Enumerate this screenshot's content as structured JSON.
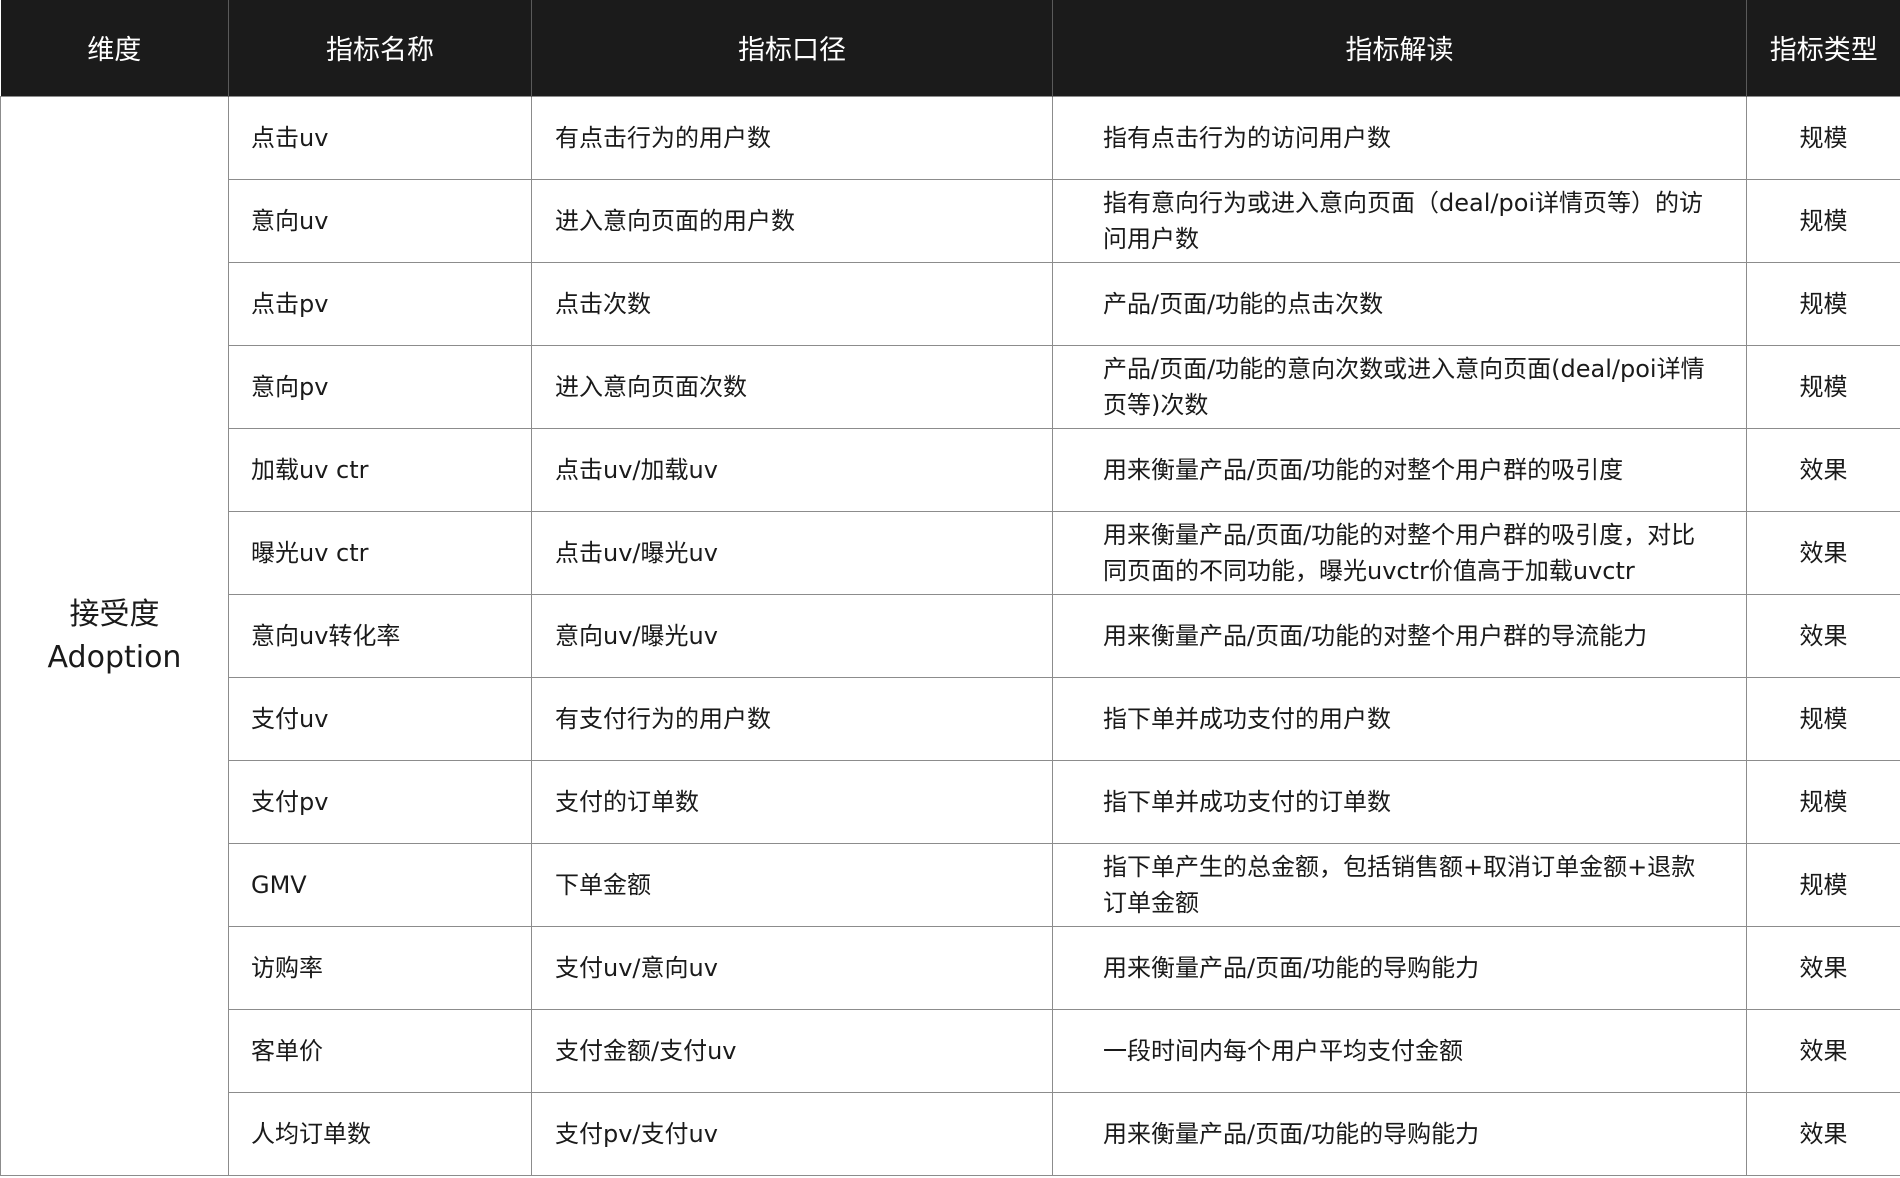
{
  "headers": [
    "维度",
    "指标名称",
    "指标口径",
    "指标解读",
    "指标类型"
  ],
  "dimension": {
    "zh": "接受度",
    "en": "Adoption"
  },
  "rows": [
    {
      "name": "点击uv",
      "definition": "有点击行为的用户数",
      "interpretation": "指有点击行为的访问用户数",
      "type": "规模"
    },
    {
      "name": "意向uv",
      "definition": "进入意向页面的用户数",
      "interpretation": "指有意向行为或进入意向页面（deal/poi详情页等）的访问用户数",
      "type": "规模"
    },
    {
      "name": "点击pv",
      "definition": "点击次数",
      "interpretation": "产品/页面/功能的点击次数",
      "type": "规模"
    },
    {
      "name": "意向pv",
      "definition": "进入意向页面次数",
      "interpretation": "产品/页面/功能的意向次数或进入意向页面(deal/poi详情页等)次数",
      "type": "规模"
    },
    {
      "name": "加载uv ctr",
      "definition": "点击uv/加载uv",
      "interpretation": "用来衡量产品/页面/功能的对整个用户群的吸引度",
      "type": "效果"
    },
    {
      "name": "曝光uv ctr",
      "definition": "点击uv/曝光uv",
      "interpretation": "用来衡量产品/页面/功能的对整个用户群的吸引度，对比同页面的不同功能，曝光uvctr价值高于加载uvctr",
      "type": "效果"
    },
    {
      "name": "意向uv转化率",
      "definition": "意向uv/曝光uv",
      "interpretation": "用来衡量产品/页面/功能的对整个用户群的导流能力",
      "type": "效果"
    },
    {
      "name": "支付uv",
      "definition": "有支付行为的用户数",
      "interpretation": "指下单并成功支付的用户数",
      "type": "规模"
    },
    {
      "name": "支付pv",
      "definition": "支付的订单数",
      "interpretation": "指下单并成功支付的订单数",
      "type": "规模"
    },
    {
      "name": "GMV",
      "definition": "下单金额",
      "interpretation": "指下单产生的总金额，包括销售额+取消订单金额+退款订单金额",
      "type": "规模"
    },
    {
      "name": "访购率",
      "definition": "支付uv/意向uv",
      "interpretation": "用来衡量产品/页面/功能的导购能力",
      "type": "效果"
    },
    {
      "name": "客单价",
      "definition": "支付金额/支付uv",
      "interpretation": "一段时间内每个用户平均支付金额",
      "type": "效果"
    },
    {
      "name": "人均订单数",
      "definition": "支付pv/支付uv",
      "interpretation": "用来衡量产品/页面/功能的导购能力",
      "type": "效果"
    }
  ]
}
